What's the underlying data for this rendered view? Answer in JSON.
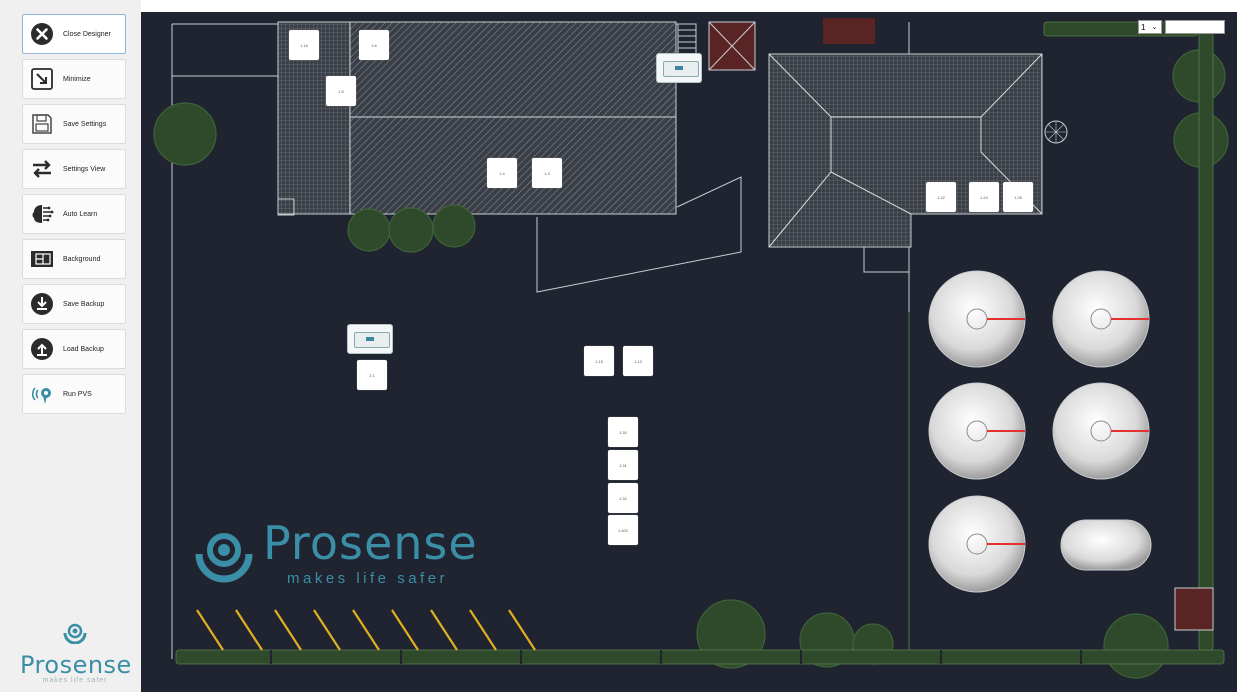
{
  "sidebar": {
    "buttons": [
      {
        "label": "Close Designer",
        "icon": "close-icon"
      },
      {
        "label": "Minimize",
        "icon": "minimize-icon"
      },
      {
        "label": "Save Settings",
        "icon": "save-settings-icon"
      },
      {
        "label": "Settings View",
        "icon": "swap-icon"
      },
      {
        "label": "Auto Learn",
        "icon": "brain-icon"
      },
      {
        "label": "Background",
        "icon": "background-icon"
      },
      {
        "label": "Save Backup",
        "icon": "download-icon"
      },
      {
        "label": "Load Backup",
        "icon": "upload-icon"
      },
      {
        "label": "Run PVS",
        "icon": "pvs-icon"
      }
    ],
    "logo": {
      "word": "Prosense",
      "tagline": "makes life safer"
    }
  },
  "canvas": {
    "brand": {
      "word": "Prosense",
      "tagline": "makes life safer"
    },
    "level_select": {
      "value": "1"
    },
    "name_input": {
      "value": ""
    },
    "sensors": [
      {
        "label": "1.16"
      },
      {
        "label": "1.6"
      },
      {
        "label": "1.5"
      },
      {
        "label": "1.4"
      },
      {
        "label": "1.3"
      },
      {
        "label": "1.22"
      },
      {
        "label": "1.24"
      },
      {
        "label": "1.25"
      },
      {
        "label": "2.1"
      },
      {
        "label": "1.15"
      },
      {
        "label": "1.12"
      },
      {
        "label": "1.30"
      },
      {
        "label": "1.31"
      },
      {
        "label": "1.32"
      },
      {
        "label": "1.402"
      }
    ],
    "pvs_devices": 2
  },
  "colors": {
    "canvas_bg": "#1f2430",
    "brand": "#3a8ea6",
    "tank_gauge": "#e53030",
    "tree": "#2f4a2a",
    "parking_line": "#e0b020"
  }
}
